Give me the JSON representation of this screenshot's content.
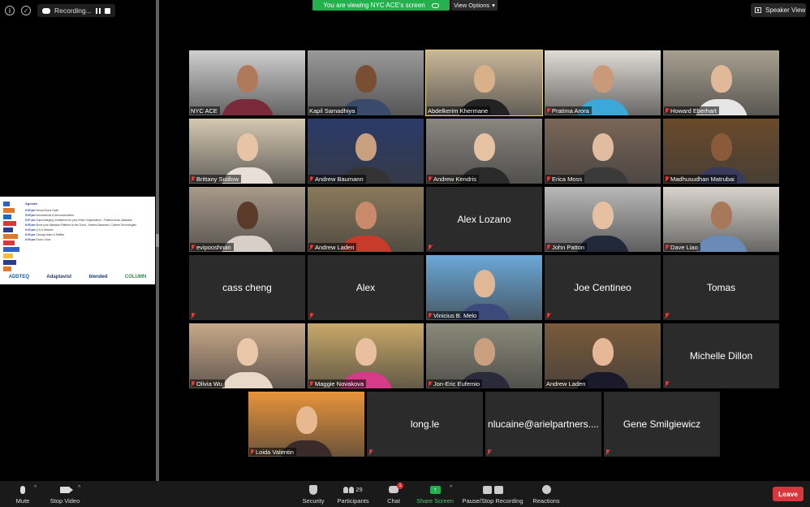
{
  "window": {
    "recording_label": "Recording...",
    "banner_text": "You are viewing NYC ACE's screen",
    "view_options_label": "View Options",
    "speaker_view_label": "Speaker View"
  },
  "slide": {
    "title": "Agenda",
    "rows": [
      {
        "time": "5:00 pm",
        "text": "Virtual Doors Open"
      },
      {
        "time": "5:05 pm",
        "text": "Introductions & Announcements"
      },
      {
        "time": "5:07 pm",
        "text": "Supercharging Confluence for your Entire Organization - Pratima Arora, Atlassian"
      },
      {
        "time": "6:05 pm",
        "text": "Move your Atlassian Platform to the Cloud - Andrew Baumann, Column Technologies"
      },
      {
        "time": "6:20 pm",
        "text": "Q & A Session"
      },
      {
        "time": "6:25 pm",
        "text": "Closing Notes & Raffles"
      },
      {
        "time": "6:30 pm",
        "text": "Doors Close"
      }
    ],
    "logos": [
      "ADDTEQ",
      "Adaptavist",
      "blended",
      "COLUMN"
    ]
  },
  "participants": [
    {
      "name": "NYC ACE",
      "video": true,
      "muted": false,
      "active": false,
      "skin": "#b07a5a",
      "shirt": "#7a2a3a",
      "bg": "#cfcfcf"
    },
    {
      "name": "Kapil Samadhiya",
      "video": true,
      "muted": false,
      "active": false,
      "skin": "#7a4e32",
      "shirt": "#3a4a6a",
      "bg": "#9a9a9a"
    },
    {
      "name": "Abdelkerim Khermane",
      "video": true,
      "muted": false,
      "active": true,
      "skin": "#d8b08a",
      "shirt": "#222222",
      "bg": "#c9b79a"
    },
    {
      "name": "Pratima Arora",
      "video": true,
      "muted": true,
      "active": false,
      "skin": "#c89a7a",
      "shirt": "#3aa8d8",
      "bg": "#e0dcd6"
    },
    {
      "name": "Howard Eberhart",
      "video": true,
      "muted": true,
      "active": false,
      "skin": "#e0b89a",
      "shirt": "#e6e6e6",
      "bg": "#a8a090"
    },
    {
      "name": "Brittany Sudlow",
      "video": true,
      "muted": true,
      "active": false,
      "skin": "#e8c4a6",
      "shirt": "#e8e0d8",
      "bg": "#d4c8b0"
    },
    {
      "name": "Andrew Baumann",
      "video": true,
      "muted": true,
      "active": false,
      "skin": "#c8a080",
      "shirt": "#333333",
      "bg": "#2a3a6a"
    },
    {
      "name": "Andrew Kendris",
      "video": true,
      "muted": true,
      "active": false,
      "skin": "#e6c2a2",
      "shirt": "#2a2a2a",
      "bg": "#8a8680"
    },
    {
      "name": "Erica Moss",
      "video": true,
      "muted": true,
      "active": false,
      "skin": "#e2bca0",
      "shirt": "#3a3a3a",
      "bg": "#7a6658"
    },
    {
      "name": "Madhusudhan Matrubai",
      "video": true,
      "muted": true,
      "active": false,
      "skin": "#8a5a3a",
      "shirt": "#3a3a5a",
      "bg": "#6a4a2a"
    },
    {
      "name": "evipooshnan",
      "video": true,
      "muted": true,
      "active": false,
      "skin": "#5a3a28",
      "shirt": "#d8d0c8",
      "bg": "#a89a8a"
    },
    {
      "name": "Andrew Laden",
      "video": true,
      "muted": true,
      "active": false,
      "skin": "#c88a6a",
      "shirt": "#c83a2a",
      "bg": "#8a7a5a"
    },
    {
      "name": "Alex Lozano",
      "video": false,
      "muted": true,
      "active": false
    },
    {
      "name": "John Patton",
      "video": true,
      "muted": true,
      "active": false,
      "skin": "#e6c0a0",
      "shirt": "#222a3a",
      "bg": "#b8b8b8"
    },
    {
      "name": "Dave Liao",
      "video": true,
      "muted": true,
      "active": false,
      "skin": "#a8785a",
      "shirt": "#6a8ab8",
      "bg": "#d8d4cc"
    },
    {
      "name": "cass cheng",
      "video": false,
      "muted": true,
      "active": false
    },
    {
      "name": "Alex",
      "video": false,
      "muted": true,
      "active": false
    },
    {
      "name": "Vinicius B. Melo",
      "video": true,
      "muted": true,
      "active": false,
      "skin": "#e0b898",
      "shirt": "#3a4a7a",
      "bg": "#6aa8d8"
    },
    {
      "name": "Joe Centineo",
      "video": false,
      "muted": true,
      "active": false
    },
    {
      "name": "Tomas",
      "video": false,
      "muted": true,
      "active": false
    },
    {
      "name": "Olivia Wu",
      "video": true,
      "muted": true,
      "active": false,
      "skin": "#e8c8a8",
      "shirt": "#e8d8c8",
      "bg": "#c8a888"
    },
    {
      "name": "Maggie Novakova",
      "video": true,
      "muted": true,
      "active": false,
      "skin": "#e8c0a0",
      "shirt": "#d83a8a",
      "bg": "#c8a868"
    },
    {
      "name": "Jon-Eric Eufemio",
      "video": true,
      "muted": true,
      "active": false,
      "skin": "#c8a080",
      "shirt": "#2a2a3a",
      "bg": "#8a8a7a"
    },
    {
      "name": "Andrew Laden",
      "video": true,
      "muted": false,
      "active": false,
      "skin": "#e6b898",
      "shirt": "#1a1a2a",
      "bg": "#7a5a3a"
    },
    {
      "name": "Michelle Dillon",
      "video": false,
      "muted": true,
      "active": false
    },
    {
      "name": "Loida Valentin",
      "video": true,
      "muted": true,
      "active": false,
      "skin": "#e8b890",
      "shirt": "#3a2a2a",
      "bg": "#e8943a"
    },
    {
      "name": "long.le",
      "video": false,
      "muted": true,
      "active": false
    },
    {
      "name": "nlucaine@arielpartners....",
      "video": false,
      "muted": true,
      "active": false
    },
    {
      "name": "Gene Smilgiewicz",
      "video": false,
      "muted": true,
      "active": false
    }
  ],
  "toolbar": {
    "mute_label": "Mute",
    "stop_video_label": "Stop Video",
    "security_label": "Security",
    "participants_label": "Participants",
    "participants_count": "29",
    "chat_label": "Chat",
    "chat_badge": "1",
    "share_screen_label": "Share Screen",
    "pause_stop_label": "Pause/Stop Recording",
    "reactions_label": "Reactions",
    "leave_label": "Leave"
  },
  "colors": {
    "banner_green": "#22b14c",
    "leave_red": "#d9363e",
    "active_speaker": "#e8d46a",
    "muted_red": "#e13b3b"
  }
}
